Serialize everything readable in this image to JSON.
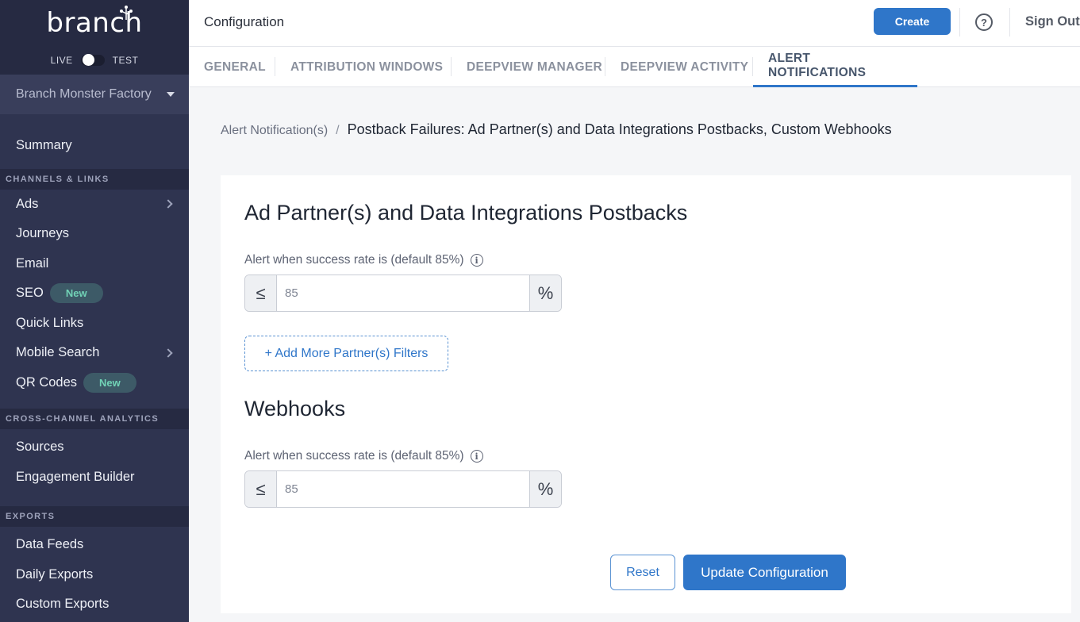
{
  "brand": {
    "logo_text": "branch"
  },
  "env": {
    "live_label": "LIVE",
    "test_label": "TEST"
  },
  "org": {
    "name": "Branch Monster Factory"
  },
  "sidebar": {
    "summary": "Summary",
    "section_channels": "CHANNELS & LINKS",
    "channels": [
      {
        "label": "Ads",
        "has_chevron": true
      },
      {
        "label": "Journeys"
      },
      {
        "label": "Email"
      },
      {
        "label": "SEO",
        "badge": "New"
      },
      {
        "label": "Quick Links"
      },
      {
        "label": "Mobile Search",
        "has_chevron": true
      },
      {
        "label": "QR Codes",
        "badge": "New"
      }
    ],
    "section_analytics": "CROSS-CHANNEL ANALYTICS",
    "analytics": [
      {
        "label": "Sources"
      },
      {
        "label": "Engagement Builder"
      }
    ],
    "section_exports": "EXPORTS",
    "exports": [
      {
        "label": "Data Feeds"
      },
      {
        "label": "Daily Exports"
      },
      {
        "label": "Custom Exports"
      }
    ]
  },
  "header": {
    "title": "Configuration",
    "create_label": "Create",
    "help_glyph": "?",
    "sign_out_label": "Sign Out"
  },
  "tabs": [
    {
      "label": "GENERAL"
    },
    {
      "label": "ATTRIBUTION WINDOWS"
    },
    {
      "label": "DEEPVIEW MANAGER"
    },
    {
      "label": "DEEPVIEW ACTIVITY"
    },
    {
      "label": "ALERT NOTIFICATIONS",
      "active": true
    }
  ],
  "breadcrumb": {
    "parent": "Alert Notification(s)",
    "separator": "/",
    "current": "Postback Failures: Ad Partner(s) and Data Integrations Postbacks, Custom Webhooks"
  },
  "partners_section": {
    "title": "Ad Partner(s) and Data Integrations Postbacks",
    "label": "Alert when success rate is (default 85%)",
    "prefix": "≤",
    "value": "85",
    "suffix": "%",
    "add_filters_label": "+ Add More Partner(s) Filters"
  },
  "webhooks_section": {
    "title": "Webhooks",
    "label": "Alert when success rate is (default 85%)",
    "prefix": "≤",
    "value": "85",
    "suffix": "%"
  },
  "actions": {
    "reset_label": "Reset",
    "update_label": "Update Configuration"
  },
  "colors": {
    "sidebar_bg": "#2f3450",
    "accent": "#2f76c9",
    "badge_text": "#71d2b6"
  }
}
